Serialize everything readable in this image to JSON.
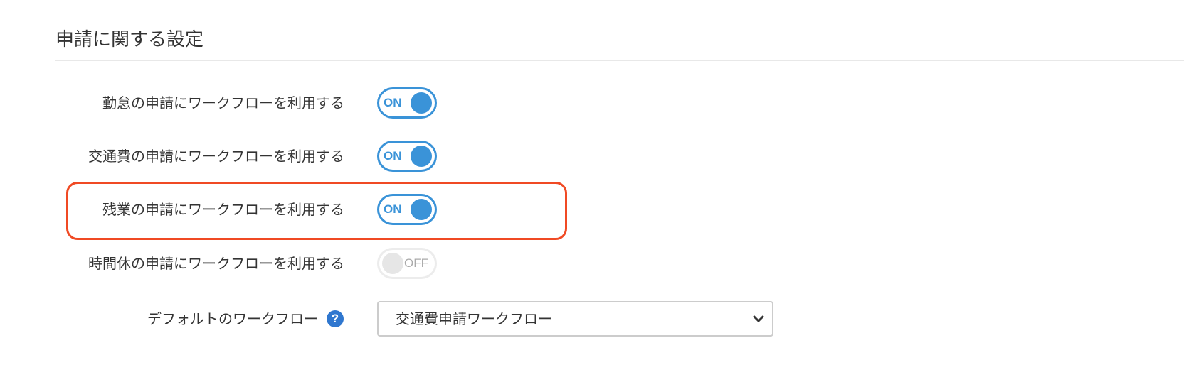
{
  "section": {
    "title": "申請に関する設定"
  },
  "settings": [
    {
      "label": "勤怠の申請にワークフローを利用する",
      "state": "ON"
    },
    {
      "label": "交通費の申請にワークフローを利用する",
      "state": "ON"
    },
    {
      "label": "残業の申請にワークフローを利用する",
      "state": "ON"
    },
    {
      "label": "時間休の申請にワークフローを利用する",
      "state": "OFF"
    }
  ],
  "default_workflow": {
    "label": "デフォルトのワークフロー",
    "help_icon": "question-circle-icon",
    "help_glyph": "?",
    "selected_value": "交通費申請ワークフロー"
  },
  "colors": {
    "accent": "#3a93d8",
    "highlight": "#f04a24",
    "help_icon": "#2f77cf",
    "off_border": "#ececec"
  }
}
